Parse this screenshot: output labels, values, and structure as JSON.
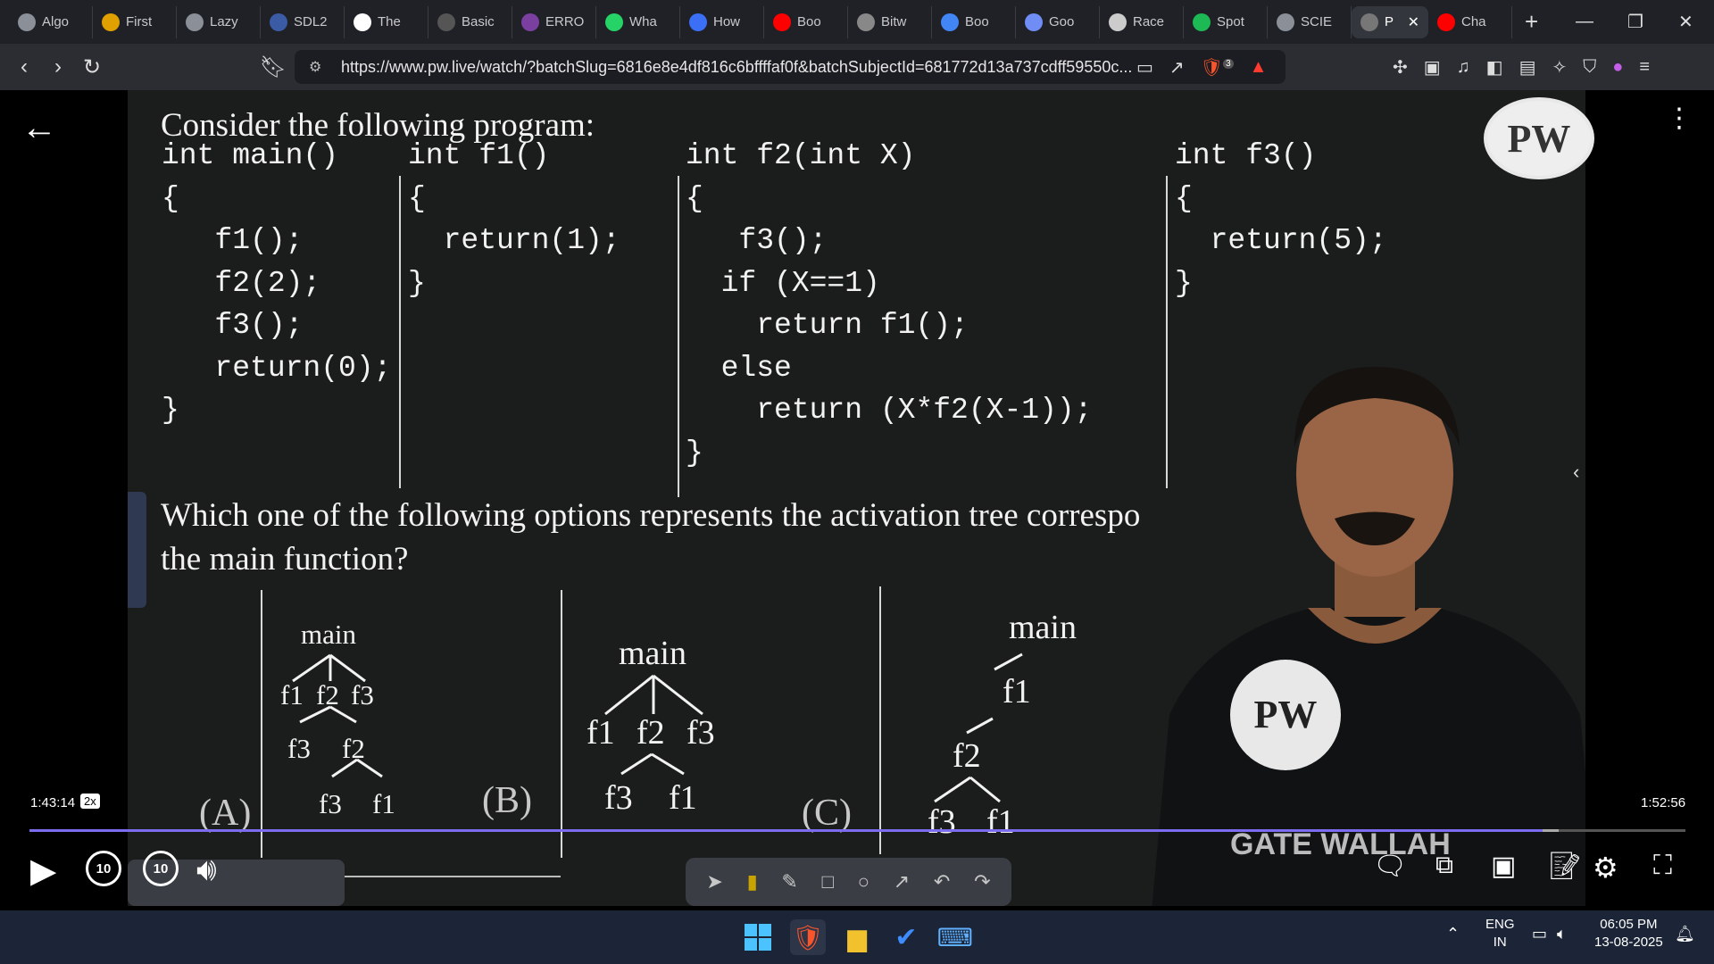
{
  "browser": {
    "tabs": [
      {
        "label": "Algo",
        "icon": "chatgpt-icon",
        "color": "#8a8f98"
      },
      {
        "label": "First",
        "icon": "bolt-icon",
        "color": "#e0a000"
      },
      {
        "label": "Lazy",
        "icon": "globe-icon",
        "color": "#8a8f98"
      },
      {
        "label": "SDL2",
        "icon": "sdl-icon",
        "color": "#3b5ba5"
      },
      {
        "label": "The",
        "icon": "w3schools-icon",
        "color": "#ffffff"
      },
      {
        "label": "Basic",
        "icon": "site-icon",
        "color": "#555555"
      },
      {
        "label": "ERRO",
        "icon": "error-icon",
        "color": "#7b3fa0"
      },
      {
        "label": "Wha",
        "icon": "whatsapp-icon",
        "color": "#25d366"
      },
      {
        "label": "How",
        "icon": "copilot-icon",
        "color": "#3b6ff5"
      },
      {
        "label": "Boo",
        "icon": "youtube-icon",
        "color": "#ff0000"
      },
      {
        "label": "Bitw",
        "icon": "bitwise-icon",
        "color": "#888888"
      },
      {
        "label": "Boo",
        "icon": "google-icon",
        "color": "#4285f4"
      },
      {
        "label": "Goo",
        "icon": "gemini-icon",
        "color": "#6f8df5"
      },
      {
        "label": "Race",
        "icon": "openai-icon",
        "color": "#cccccc"
      },
      {
        "label": "Spot",
        "icon": "spotify-icon",
        "color": "#1db954"
      },
      {
        "label": "SCIE",
        "icon": "globe-icon",
        "color": "#8a8f98"
      },
      {
        "label": "P",
        "icon": "audio-icon",
        "color": "#777777",
        "active": true
      },
      {
        "label": "Cha",
        "icon": "youtube-icon",
        "color": "#ff0000"
      }
    ],
    "url": "https://www.pw.live/watch/?batchSlug=6816e8e4df816c6bffffaf0f&batchSubjectId=681772d13a737cdff59550c...",
    "shield_badge": "3"
  },
  "lecture": {
    "heading": "Consider the following program:",
    "code_columns": [
      {
        "text": "int main()\n{\n   f1();\n   f2(2);\n   f3();\n   return(0);\n}"
      },
      {
        "text": "int f1()\n{\n  return(1);\n}"
      },
      {
        "text": "int f2(int X)\n{\n   f3();\n  if (X==1)\n    return f1();\n  else\n    return (X*f2(X-1));\n}"
      },
      {
        "text": "int f3()\n{\n  return(5);\n}"
      }
    ],
    "question_line1": "Which one of the following options represents the activation tree correspo",
    "question_line2": "the main function?",
    "options": [
      {
        "label": "(A)",
        "nodes": [
          "main",
          "f1",
          "f2",
          "f3",
          "f3",
          "f2",
          "f3",
          "f1"
        ]
      },
      {
        "label": "(B)",
        "nodes": [
          "main",
          "f1",
          "f2",
          "f3",
          "f3",
          "f1"
        ]
      },
      {
        "label": "(C)",
        "nodes": [
          "main",
          "f1",
          "f2",
          "f3",
          "f1"
        ]
      }
    ],
    "logo_text": "PW",
    "banner_text": "GATE WALLAH"
  },
  "player": {
    "current_time": "1:43:14",
    "speed": "2x",
    "total_time": "1:52:56",
    "progress_fraction": 0.914,
    "skip_back_label": "10",
    "skip_fwd_label": "10"
  },
  "taskbar": {
    "language": "ENG",
    "region": "IN",
    "time": "06:05 PM",
    "date": "13-08-2025"
  }
}
